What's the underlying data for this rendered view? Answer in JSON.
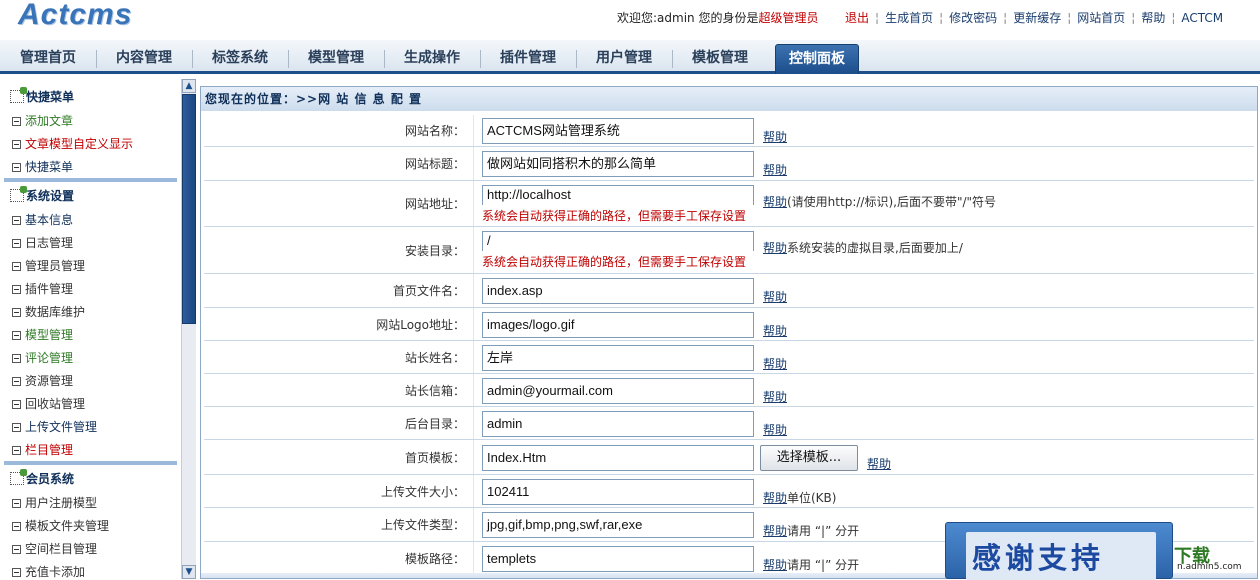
{
  "logo": "Actcms",
  "header": {
    "welcome_prefix": "欢迎您:admin 您的身份是",
    "role": "超级管理员",
    "links": [
      "退出",
      "生成首页",
      "修改密码",
      "更新缓存",
      "网站首页",
      "帮助",
      "ACTCM"
    ]
  },
  "nav": {
    "tabs": [
      "管理首页",
      "内容管理",
      "标签系统",
      "模型管理",
      "生成操作",
      "插件管理",
      "用户管理",
      "模板管理",
      "控制面板"
    ],
    "active_index": 8
  },
  "sidebar": {
    "groups": [
      {
        "title": "快捷菜单",
        "items": [
          {
            "label": "添加文章",
            "color": "#2f7a25"
          },
          {
            "label": "文章模型自定义显示",
            "color": "#c00000"
          },
          {
            "label": "快捷菜单",
            "color": "#10305a"
          }
        ]
      },
      {
        "title": "系统设置",
        "items": [
          {
            "label": "基本信息",
            "color": "#10305a"
          },
          {
            "label": "日志管理",
            "color": "#333333"
          },
          {
            "label": "管理员管理",
            "color": "#333333"
          },
          {
            "label": "插件管理",
            "color": "#333333"
          },
          {
            "label": "数据库维护",
            "color": "#333333"
          },
          {
            "label": "模型管理",
            "color": "#2f7a25"
          },
          {
            "label": "评论管理",
            "color": "#2f7a25"
          },
          {
            "label": "资源管理",
            "color": "#333333"
          },
          {
            "label": "回收站管理",
            "color": "#333333"
          },
          {
            "label": "上传文件管理",
            "color": "#10305a"
          },
          {
            "label": "栏目管理",
            "color": "#c00000"
          }
        ]
      },
      {
        "title": "会员系统",
        "items": [
          {
            "label": "用户注册模型",
            "color": "#333333"
          },
          {
            "label": "模板文件夹管理",
            "color": "#333333"
          },
          {
            "label": "空间栏目管理",
            "color": "#333333"
          },
          {
            "label": "充值卡添加",
            "color": "#333333"
          }
        ]
      }
    ]
  },
  "breadcrumb": "您现在的位置：>>网 站 信 息 配 置",
  "help_label": "帮助",
  "form": {
    "fields": [
      {
        "label": "网站名称：",
        "value": "ACTCMS网站管理系统",
        "hint": ""
      },
      {
        "label": "网站标题：",
        "value": "做网站如同搭积木的那么简单",
        "hint": ""
      },
      {
        "label": "网站地址：",
        "value": "http://localhost",
        "error": "系统会自动获得正确的路径，但需要手工保存设置",
        "hint": " (请使用http://标识),后面不要带\"/\"符号"
      },
      {
        "label": "安装目录：",
        "value": "/",
        "error": "系统会自动获得正确的路径，但需要手工保存设置",
        "hint": " 系统安装的虚拟目录,后面要加上/"
      },
      {
        "label": "首页文件名：",
        "value": "index.asp",
        "hint": ""
      },
      {
        "label": "网站Logo地址：",
        "value": "images/logo.gif",
        "hint": ""
      },
      {
        "label": "站长姓名：",
        "value": "左岸",
        "hint": ""
      },
      {
        "label": "站长信箱：",
        "value": "admin@yourmail.com",
        "hint": ""
      },
      {
        "label": "后台目录：",
        "value": "admin",
        "hint": ""
      },
      {
        "label": "首页模板：",
        "value": "Index.Htm",
        "button": "选择模板...",
        "hint": ""
      },
      {
        "label": "上传文件大小：",
        "value": "102411",
        "hint": "单位(KB)"
      },
      {
        "label": "上传文件类型：",
        "value": "jpg,gif,bmp,png,swf,rar,exe",
        "hint": "请用 “|” 分开"
      },
      {
        "label": "模板路径：",
        "value": "templets",
        "hint": "请用 “|” 分开"
      }
    ]
  },
  "ad": {
    "text": "感谢支持",
    "download": "下载",
    "url": "n.admin5.com"
  }
}
